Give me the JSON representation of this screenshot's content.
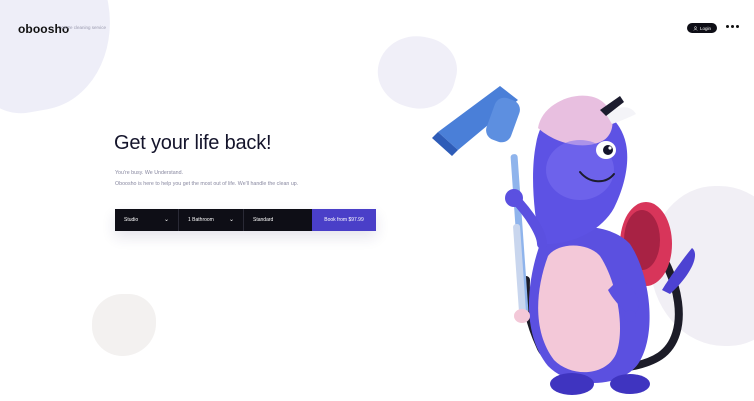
{
  "header": {
    "logo": "oboosho",
    "tagline": "You're cleaning service",
    "login_label": "Login"
  },
  "hero": {
    "title": "Get your life back!",
    "subtitle_line1": "You're busy. We Understand.",
    "subtitle_line2": "Oboosho is here to help you get the most out of life. We'll handle the clean up."
  },
  "booking": {
    "size": "Studio",
    "bathrooms": "1 Bathroom",
    "clean_type": "Standard",
    "cta": "Book from $97.99"
  },
  "colors": {
    "accent": "#4a3fc8",
    "dark": "#0e0e16",
    "mascot_body": "#5b50e0",
    "mascot_belly": "#f3c8d8",
    "vacuum": "#4a7fd8"
  },
  "icons": {
    "login": "user-icon",
    "more": "more-dots-icon",
    "dropdown": "chevron-down-icon"
  }
}
